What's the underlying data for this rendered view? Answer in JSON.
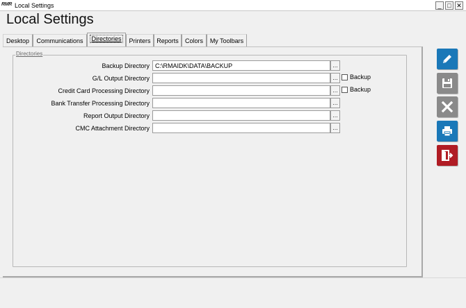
{
  "window": {
    "logo": "RMR",
    "title": "Local Settings",
    "controls": {
      "minimize": "_",
      "maximize": "□",
      "close": "✕"
    }
  },
  "page": {
    "title": "Local Settings"
  },
  "tabs": [
    {
      "label": "Desktop"
    },
    {
      "label": "Communications"
    },
    {
      "label": "Directories",
      "active": true
    },
    {
      "label": "Printers"
    },
    {
      "label": "Reports"
    },
    {
      "label": "Colors"
    },
    {
      "label": "My Toolbars"
    }
  ],
  "group": {
    "legend": "Directories",
    "browse_label": "...",
    "rows": [
      {
        "label": "Backup Directory",
        "value": "C:\\RMAIDK\\DATA\\BACKUP"
      },
      {
        "label": "G/L Output Directory",
        "value": "",
        "checkbox_label": "Backup",
        "checked": false
      },
      {
        "label": "Credit Card Processing Directory",
        "value": "",
        "checkbox_label": "Backup",
        "checked": false
      },
      {
        "label": "Bank Transfer Processing Directory",
        "value": ""
      },
      {
        "label": "Report Output Directory",
        "value": ""
      },
      {
        "label": "CMC Attachment Directory",
        "value": ""
      }
    ]
  },
  "actions": [
    {
      "name": "edit",
      "icon": "pencil-icon",
      "color": "#1a78b8"
    },
    {
      "name": "save",
      "icon": "floppy-disk-icon",
      "color": "#8a8a8a"
    },
    {
      "name": "cancel",
      "icon": "x-icon",
      "color": "#8a8a8a"
    },
    {
      "name": "print",
      "icon": "printer-icon",
      "color": "#1a78b8"
    },
    {
      "name": "exit",
      "icon": "exit-door-icon",
      "color": "#b01c24"
    }
  ]
}
